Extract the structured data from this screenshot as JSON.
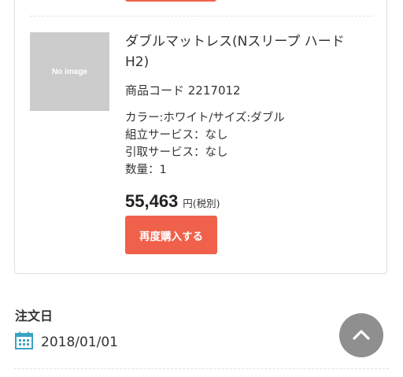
{
  "product": {
    "thumbnail_text": "No image",
    "name": "ダブルマットレス(Nスリープ ハード H2)",
    "code": "商品コード 2217012",
    "specs": [
      "カラー:ホワイト/サイズ:ダブル",
      "組立サービス：なし",
      "引取サービス：なし",
      "数量：1"
    ],
    "price": "55,463",
    "price_unit": "円(税別)",
    "rebuy_label": "再度購入する"
  },
  "order": {
    "date_label": "注文日",
    "date_value": "2018/01/01"
  },
  "colors": {
    "accent": "#f0614b",
    "thumbnail_bg": "#cccccc",
    "scroll_button": "#8f8f8f",
    "calendar_icon": "#3aa3c4"
  },
  "icons": {
    "calendar": "calendar-icon",
    "scroll_top": "chevron-up-icon"
  }
}
